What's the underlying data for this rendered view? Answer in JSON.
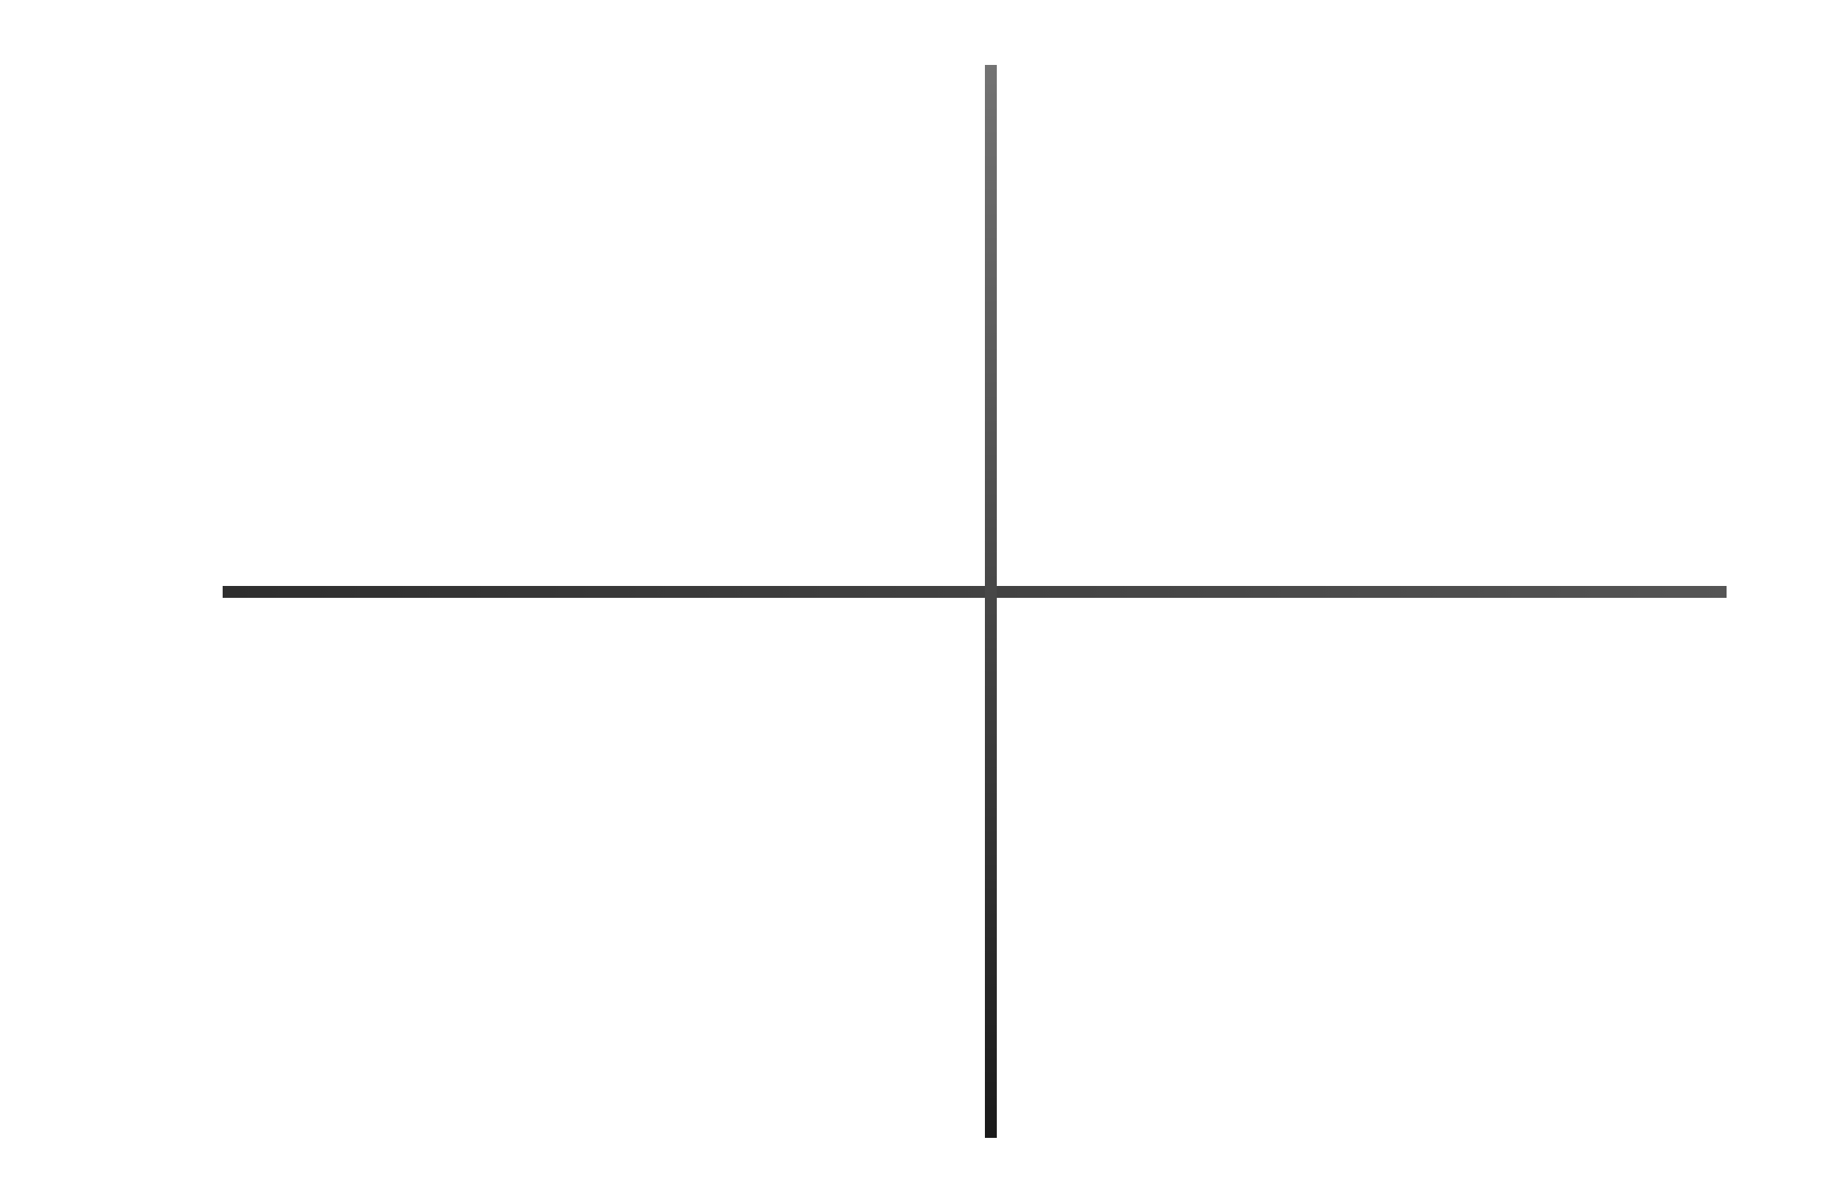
{
  "diagram": {
    "type": "cross-axes",
    "background_color": "#ffffff",
    "horizontal_line": {
      "color_start": "#2e2e2e",
      "color_end": "#555555"
    },
    "vertical_line": {
      "color_start": "#737373",
      "color_end": "#1a1a1a"
    }
  }
}
